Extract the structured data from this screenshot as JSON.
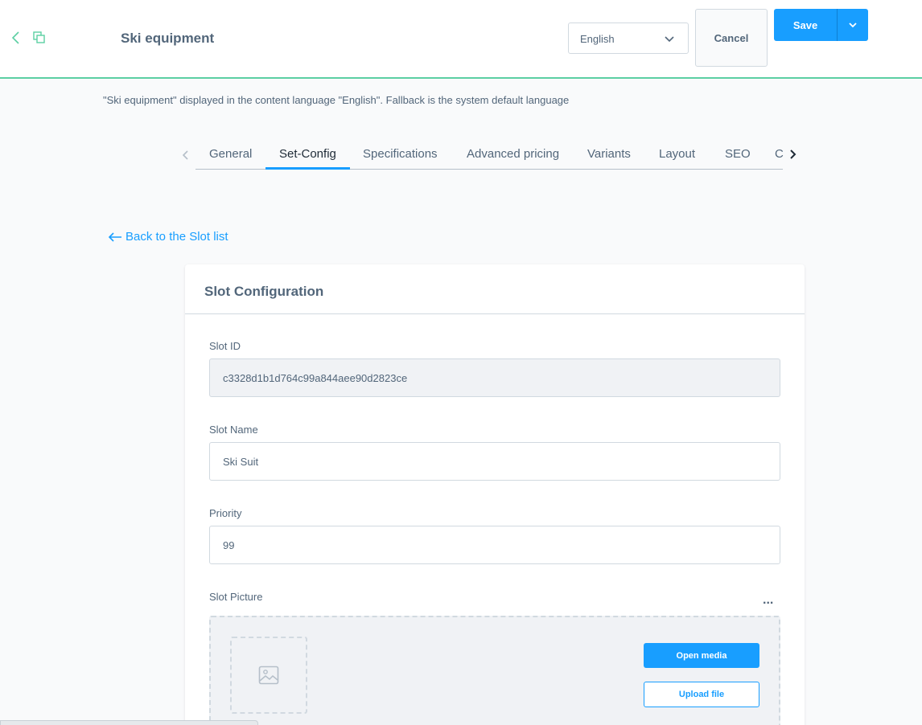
{
  "header": {
    "title": "Ski equipment",
    "language": "English",
    "cancel_label": "Cancel",
    "save_label": "Save"
  },
  "info_text": "\"Ski equipment\" displayed in the content language \"English\". Fallback is the system default language",
  "tabs": [
    {
      "label": "General"
    },
    {
      "label": "Set-Config"
    },
    {
      "label": "Specifications"
    },
    {
      "label": "Advanced pricing"
    },
    {
      "label": "Variants"
    },
    {
      "label": "Layout"
    },
    {
      "label": "SEO"
    },
    {
      "label": "C"
    }
  ],
  "active_tab": "Set-Config",
  "back_link": "Back to the Slot list",
  "card": {
    "title": "Slot Configuration",
    "slot_id_label": "Slot ID",
    "slot_id_value": "c3328d1b1d764c99a844aee90d2823ce",
    "slot_name_label": "Slot Name",
    "slot_name_value": "Ski Suit",
    "priority_label": "Priority",
    "priority_value": "99",
    "picture_label": "Slot Picture",
    "more_label": "...",
    "open_media_label": "Open media",
    "upload_file_label": "Upload file"
  },
  "colors": {
    "accent": "#189eff",
    "header_border": "#5ccfa3",
    "text": "#52667a"
  }
}
